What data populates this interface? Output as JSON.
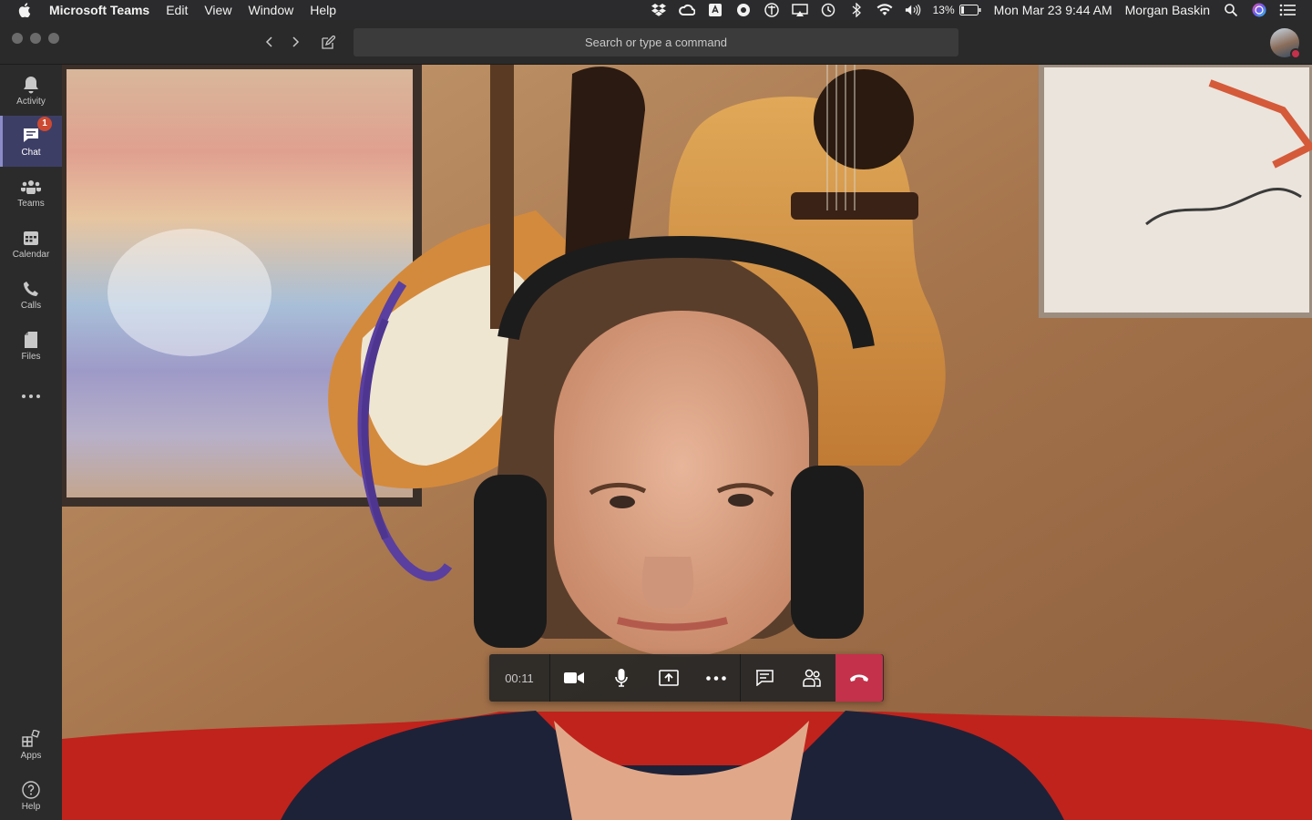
{
  "menubar": {
    "app_name": "Microsoft Teams",
    "menus": [
      "Edit",
      "View",
      "Window",
      "Help"
    ],
    "battery_percent": "13%",
    "datetime": "Mon Mar 23  9:44 AM",
    "user": "Morgan Baskin",
    "tray_icons": [
      "dropbox-icon",
      "creative-cloud-icon",
      "text-icon",
      "app-icon",
      "font-icon",
      "airplay-icon",
      "time-machine-icon",
      "bluetooth-icon",
      "wifi-icon",
      "volume-icon",
      "battery-icon",
      "spotlight-icon",
      "siri-icon",
      "notification-center-icon"
    ]
  },
  "titlebar": {
    "search_placeholder": "Search or type a command"
  },
  "rail": {
    "items": [
      {
        "label": "Activity",
        "icon": "bell-icon"
      },
      {
        "label": "Chat",
        "icon": "chat-icon",
        "badge": "1",
        "active": true
      },
      {
        "label": "Teams",
        "icon": "teams-icon"
      },
      {
        "label": "Calendar",
        "icon": "calendar-icon"
      },
      {
        "label": "Calls",
        "icon": "phone-icon"
      },
      {
        "label": "Files",
        "icon": "file-icon"
      }
    ],
    "more_icon": "more-icon",
    "bottom": [
      {
        "label": "Apps",
        "icon": "apps-icon"
      },
      {
        "label": "Help",
        "icon": "help-icon"
      }
    ]
  },
  "call": {
    "timer": "00:11",
    "controls": [
      "video-camera-icon",
      "microphone-icon",
      "share-screen-icon",
      "more-options-icon",
      "chat-icon",
      "participants-icon",
      "hang-up-icon"
    ]
  },
  "colors": {
    "rail_bg": "#2b2b2b",
    "active_rail": "#3d3e66",
    "hangup": "#c4314b",
    "badge": "#cc4a31"
  }
}
